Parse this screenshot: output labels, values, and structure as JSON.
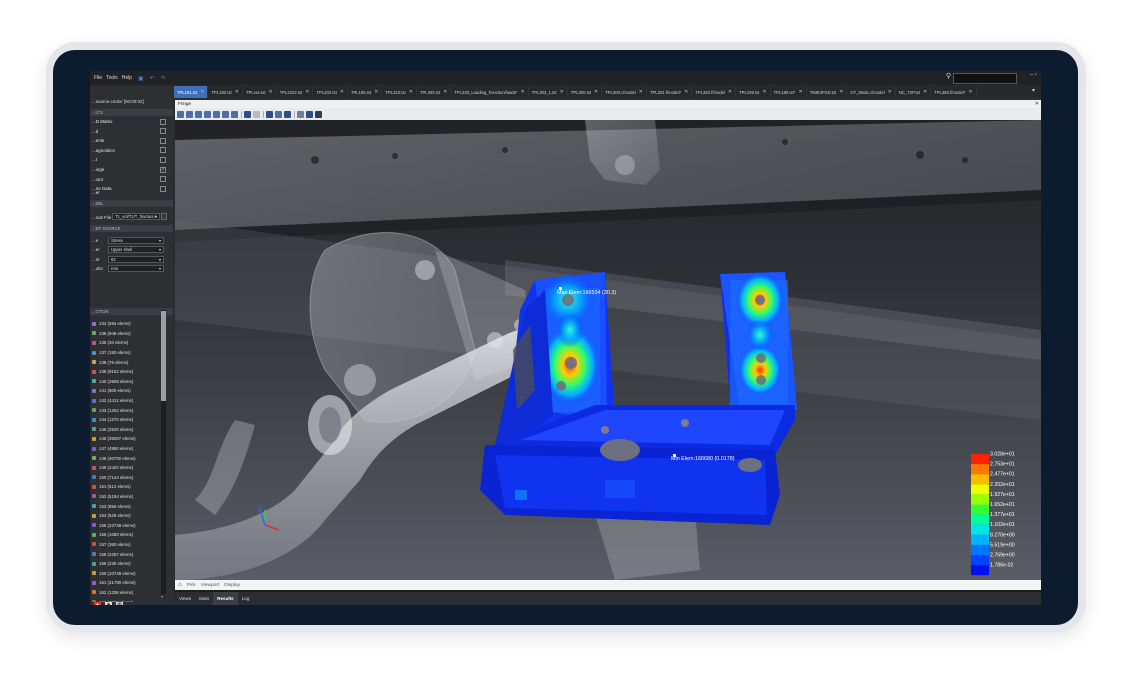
{
  "menu": {
    "items": [
      "File",
      "Tools",
      "Help"
    ]
  },
  "tabs": [
    {
      "label": "TPL191.txt",
      "active": true
    },
    {
      "label": "TPL182.txt"
    },
    {
      "label": "TPLxxx.txt"
    },
    {
      "label": "TPL2102.txt"
    },
    {
      "label": "TPL202.txt"
    },
    {
      "label": "TPL165.txt"
    },
    {
      "label": "TPL310.txt"
    },
    {
      "label": "TPL330.txt"
    },
    {
      "label": "TPL230_Loading_Function/loads*"
    },
    {
      "label": "TPL303_1.txt"
    },
    {
      "label": "TPL300.txt"
    },
    {
      "label": "TPL300.c/model"
    },
    {
      "label": "TPL201.f/model*"
    },
    {
      "label": "TPL352.f/model"
    },
    {
      "label": "TPL199.txt"
    },
    {
      "label": "TPL180.txt*"
    },
    {
      "label": "TIME2PSD.txt"
    },
    {
      "label": "CF_Static.c/model"
    },
    {
      "label": "NC_T2P.txt"
    },
    {
      "label": "TPL358.f/model*"
    }
  ],
  "left_panel": {
    "title": "...source.cmdx/ [00:00:02]",
    "section_results": "...LTS",
    "checkbox_items": [
      {
        "label": "...D Matrix",
        "checked": false
      },
      {
        "label": "...d",
        "checked": false
      },
      {
        "label": "...ents",
        "checked": false
      },
      {
        "label": "...agnostics",
        "checked": false
      },
      {
        "label": "...t",
        "checked": false
      },
      {
        "label": "...inge",
        "checked": true
      },
      {
        "label": "...ctor",
        "checked": false
      },
      {
        "label": "...ne Data",
        "checked": false
      }
    ],
    "section_label_r": "...er",
    "section_model": "...DEL",
    "result_file_label": "...sult File",
    "result_file_value": "T1_vol/T1/T_fracture.t",
    "section_source": "...ER SOURCE",
    "fields": [
      {
        "label": "...e",
        "value": "Stress"
      },
      {
        "label": "...er",
        "value": "Upper shell"
      },
      {
        "label": "...nt",
        "value": "62"
      },
      {
        "label": "...ults",
        "value": "rms"
      }
    ],
    "section_selection": "...CTION",
    "components": [
      {
        "label": "134 (594 elems)",
        "color": "#9b6fc9"
      },
      {
        "label": "135 (948 elems)",
        "color": "#5fb35f"
      },
      {
        "label": "136 (20 elems)",
        "color": "#c0568f"
      },
      {
        "label": "137 (150 elems)",
        "color": "#4f8fd4"
      },
      {
        "label": "138 (76 elems)",
        "color": "#d4a63f"
      },
      {
        "label": "139 (9152 elems)",
        "color": "#c25a5a"
      },
      {
        "label": "140 (2808 elems)",
        "color": "#48b0a0"
      },
      {
        "label": "141 (800 elems)",
        "color": "#8c6fd0"
      },
      {
        "label": "142 (4412 elems)",
        "color": "#6a6adf"
      },
      {
        "label": "143 (1252 elems)",
        "color": "#5aa85a"
      },
      {
        "label": "144 (1270 elems)",
        "color": "#3f8ed0"
      },
      {
        "label": "145 (2520 elems)",
        "color": "#4aa3a3"
      },
      {
        "label": "146 (25097 elems)",
        "color": "#d0a03c"
      },
      {
        "label": "147 (4890 elems)",
        "color": "#7a63c8"
      },
      {
        "label": "148 (40700 elems)",
        "color": "#6cb84a"
      },
      {
        "label": "149 (2420 elems)",
        "color": "#c94f7a"
      },
      {
        "label": "150 (7144 elems)",
        "color": "#3f7fc8"
      },
      {
        "label": "151 (512 elems)",
        "color": "#c85a3a"
      },
      {
        "label": "152 (5184 elems)",
        "color": "#9a5ac2"
      },
      {
        "label": "153 (856 elems)",
        "color": "#3fa8b8"
      },
      {
        "label": "154 (528 elems)",
        "color": "#d49a3a"
      },
      {
        "label": "155 (22748 elems)",
        "color": "#8a5ac8"
      },
      {
        "label": "156 (1080 elems)",
        "color": "#55b35a"
      },
      {
        "label": "157 (360 elems)",
        "color": "#c84f4f"
      },
      {
        "label": "158 (4287 elems)",
        "color": "#4a7ad0"
      },
      {
        "label": "159 (230 elems)",
        "color": "#4aa896"
      },
      {
        "label": "160 (10748 elems)",
        "color": "#c89a3a"
      },
      {
        "label": "161 (21780 elems)",
        "color": "#a65ac8"
      },
      {
        "label": "162 (1336 elems)",
        "color": "#d07a3a"
      },
      {
        "label": "163 (3382 elems)",
        "color": "#4f8f4f"
      }
    ]
  },
  "main": {
    "title": "Fringe",
    "pickbar": {
      "pick": "Pick",
      "viewport": "Viewport",
      "display": "Display"
    },
    "annotation_max": "Max Elem:166534 (30.3)",
    "annotation_min": "Min Elem:166680 (0.0178)",
    "legend": {
      "colors": [
        "#ff2200",
        "#ff7700",
        "#ffbb00",
        "#eaff00",
        "#9cff00",
        "#33ff33",
        "#00ff99",
        "#00e6e6",
        "#00b3ff",
        "#0077ff",
        "#0044ff",
        "#0011ee"
      ],
      "labels": [
        "3.028e+01",
        "2.753e+01",
        "2.477e+01",
        "2.202e+01",
        "1.927e+01",
        "1.652e+01",
        "1.377e+01",
        "1.102e+01",
        "8.270e+00",
        "5.519e+00",
        "2.769e+00",
        "1.786e-02"
      ]
    }
  },
  "bottom_tabs": [
    {
      "label": "Views"
    },
    {
      "label": "Main"
    },
    {
      "label": "Results",
      "active": true
    },
    {
      "label": "Log"
    }
  ]
}
